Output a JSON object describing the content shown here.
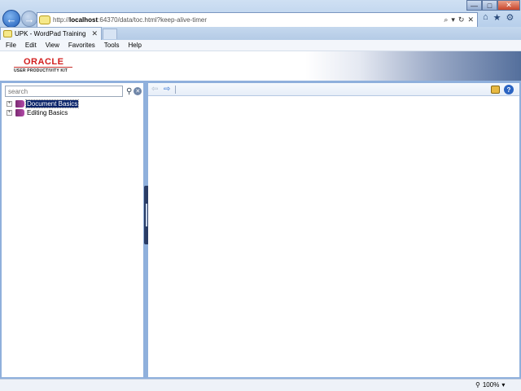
{
  "browser": {
    "url_prefix": "http://",
    "url_host": "localhost",
    "url_rest": ":64370/data/toc.html?keep-alive-timer",
    "tab_title": "UPK - WordPad Training",
    "tab_close": "✕",
    "window_controls": {
      "minimize": "—",
      "maximize": "□",
      "close": "✕"
    },
    "address_tools": {
      "search": "⌕",
      "dropdown": "▾",
      "refresh": "↻",
      "stop": "✕"
    },
    "toolbar_icons": [
      "home-icon",
      "favorites-star-icon",
      "tools-gear-icon"
    ]
  },
  "menu": [
    "File",
    "Edit",
    "View",
    "Favorites",
    "Tools",
    "Help"
  ],
  "brand": {
    "oracle": "ORACLE",
    "subtitle": "USER PRODUCTIVITY KIT"
  },
  "search": {
    "placeholder": "search"
  },
  "tree": [
    {
      "label": "Document Basics",
      "selected": true
    },
    {
      "label": "Editing Basics",
      "selected": false
    }
  ],
  "status": {
    "zoom": "100%"
  },
  "colors": {
    "panel_border": "#8fb0dc",
    "selection": "#0a246a",
    "oracle_red": "#d21e1e"
  }
}
